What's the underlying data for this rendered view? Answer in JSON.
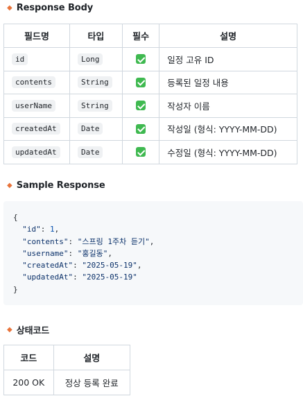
{
  "response_body": {
    "heading": "Response Body",
    "headers": [
      "필드명",
      "타입",
      "필수",
      "설명"
    ],
    "rows": [
      {
        "field": "id",
        "type": "Long",
        "required": true,
        "description": "일정 고유 ID"
      },
      {
        "field": "contents",
        "type": "String",
        "required": true,
        "description": "등록된 일정 내용"
      },
      {
        "field": "userName",
        "type": "String",
        "required": true,
        "description": "작성자 이름"
      },
      {
        "field": "createdAt",
        "type": "Date",
        "required": true,
        "description": "작성일 (형식: YYYY-MM-DD)"
      },
      {
        "field": "updatedAt",
        "type": "Date",
        "required": true,
        "description": "수정일 (형식: YYYY-MM-DD)"
      }
    ]
  },
  "sample_response": {
    "heading": "Sample Response",
    "code_lines": [
      "{",
      "  \"id\": 1,",
      "  \"contents\": \"스프링 1주차 듣기\",",
      "  \"username\": \"홍길동\",",
      "  \"createdAt\": \"2025-05-19\",",
      "  \"updatedAt\": \"2025-05-19\"",
      "}"
    ]
  },
  "status_codes": {
    "heading": "상태코드",
    "headers": [
      "코드",
      "설명"
    ],
    "rows": [
      {
        "code": "200 OK",
        "description": "정상 등록 완료"
      }
    ]
  },
  "colors": {
    "bullet": "#e8733a",
    "check": "#3fb950",
    "code_bg": "#f6f8fa"
  }
}
